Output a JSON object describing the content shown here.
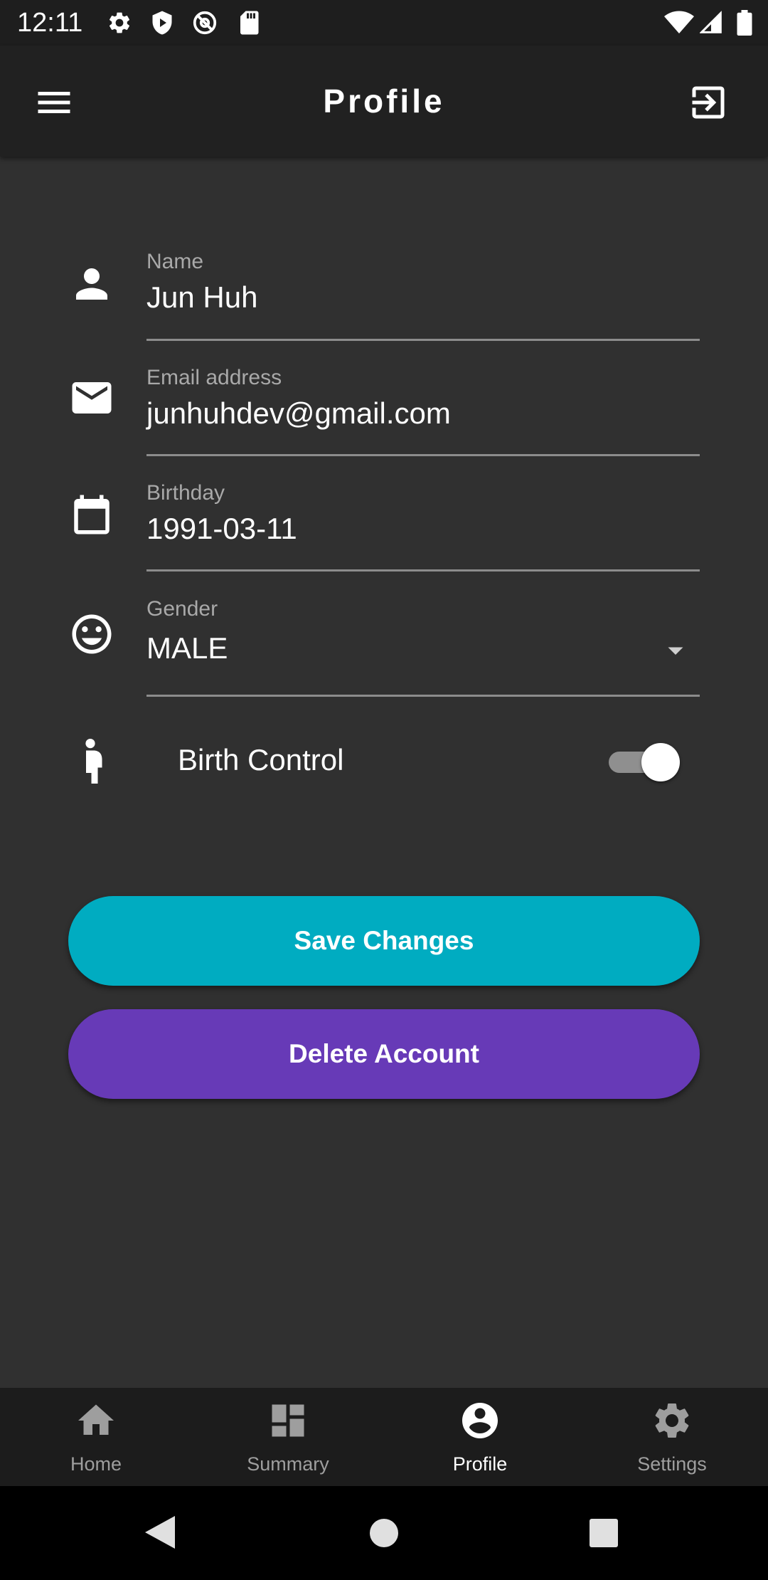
{
  "status_bar": {
    "time": "12:11",
    "icons": [
      "settings-icon",
      "shield-icon",
      "at-sign-icon",
      "sd-card-icon",
      "wifi-icon",
      "signal-icon",
      "battery-icon"
    ]
  },
  "app_bar": {
    "title": "Profile",
    "menu_icon": "hamburger-menu-icon",
    "logout_icon": "exit-icon"
  },
  "form": {
    "name": {
      "label": "Name",
      "value": "Jun Huh",
      "icon": "person-icon"
    },
    "email": {
      "label": "Email address",
      "value": "junhuhdev@gmail.com",
      "icon": "mail-icon"
    },
    "birthday": {
      "label": "Birthday",
      "value": "1991-03-11",
      "icon": "calendar-icon"
    },
    "gender": {
      "label": "Gender",
      "value": "MALE",
      "icon": "smiley-face-icon",
      "dropdown_icon": "dropdown-arrow-icon"
    },
    "birth_control": {
      "label": "Birth Control",
      "enabled": true,
      "icon": "pregnant-woman-icon"
    }
  },
  "buttons": {
    "save_label": "Save Changes",
    "delete_label": "Delete Account"
  },
  "colors": {
    "background": "#303030",
    "app_bar": "#212121",
    "save_button": "#00acc1",
    "delete_button": "#673ab7",
    "nav_active": "#ffffff",
    "nav_inactive": "#9e9e9e"
  },
  "bottom_nav": {
    "active": "Profile",
    "items": [
      {
        "label": "Home",
        "icon": "home-icon"
      },
      {
        "label": "Summary",
        "icon": "dashboard-icon"
      },
      {
        "label": "Profile",
        "icon": "account-circle-icon"
      },
      {
        "label": "Settings",
        "icon": "gear-icon"
      }
    ]
  },
  "system_nav": {
    "icons": [
      "back-icon",
      "home-circle-icon",
      "recents-icon"
    ]
  }
}
